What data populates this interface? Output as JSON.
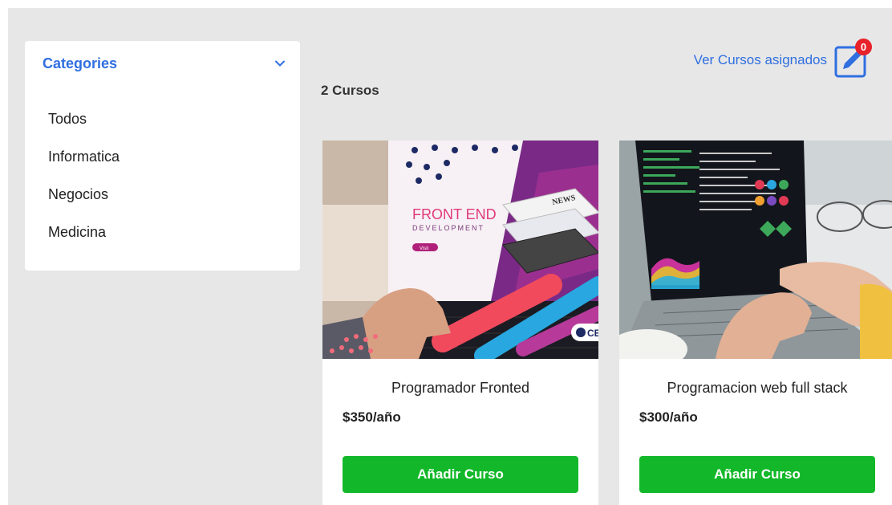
{
  "sidebar": {
    "title": "Categories",
    "items": [
      "Todos",
      "Informatica",
      "Negocios",
      "Medicina"
    ]
  },
  "header": {
    "count_label": "2 Cursos",
    "assigned_link": "Ver Cursos asignados",
    "badge_count": "0"
  },
  "courses": [
    {
      "title": "Programador Fronted",
      "price": "$350/año",
      "button": "Añadir Curso",
      "image_text_main": "FRONT END",
      "image_text_sub": "DEVELOPMENT",
      "image_tag": "NEWS",
      "image_btn": "Visit",
      "image_corner": "CE"
    },
    {
      "title": "Programacion web full stack",
      "price": "$300/año",
      "button": "Añadir Curso"
    }
  ],
  "colors": {
    "accent": "#2f6fe0",
    "button": "#13b82a",
    "badge": "#e8212a",
    "background": "#e7e7e7"
  }
}
